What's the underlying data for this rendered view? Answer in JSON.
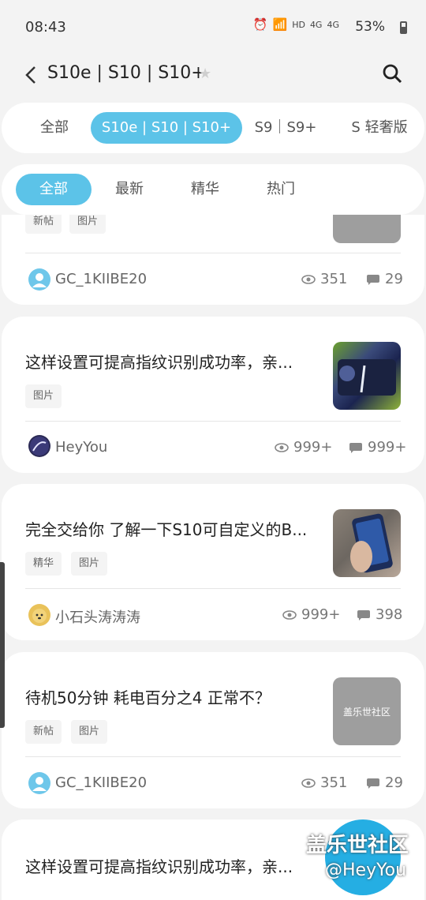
{
  "status": {
    "time": "08:43",
    "hd": "HD",
    "net1": "4G",
    "net2": "4G",
    "battery": "53%"
  },
  "header": {
    "title": "S10e | S10 | S10+"
  },
  "tabs": [
    {
      "label": "全部"
    },
    {
      "label": "S10e | S10 | S10+"
    },
    {
      "label": "S9｜S9+"
    },
    {
      "label": "S 轻奢版"
    }
  ],
  "filters": [
    {
      "label": "全部"
    },
    {
      "label": "最新"
    },
    {
      "label": "精华"
    },
    {
      "label": "热门"
    }
  ],
  "posts": [
    {
      "title": "",
      "tags": [
        "新帖",
        "图片"
      ],
      "author": "GC_1KIIBE20",
      "views": "351",
      "comments": "29"
    },
    {
      "title": "这样设置可提高指纹识别成功率，亲...",
      "tags": [
        "图片"
      ],
      "author": "HeyYou",
      "views": "999+",
      "comments": "999+"
    },
    {
      "title": "完全交给你 了解一下S10可自定义的B...",
      "tags": [
        "精华",
        "图片"
      ],
      "author": "小石头涛涛涛",
      "views": "999+",
      "comments": "398"
    },
    {
      "title": "待机50分钟  耗电百分之4  正常不？",
      "tags": [
        "新帖",
        "图片"
      ],
      "author": "GC_1KIIBE20",
      "views": "351",
      "comments": "29",
      "thumb_text": "盖乐世社区"
    },
    {
      "title": "这样设置可提高指纹识别成功率，亲..."
    }
  ],
  "watermark": {
    "line1": "盖乐世社区",
    "line2": "@HeyYou"
  },
  "colors": {
    "accent": "#5cc3e8",
    "fab": "#25aee3"
  }
}
